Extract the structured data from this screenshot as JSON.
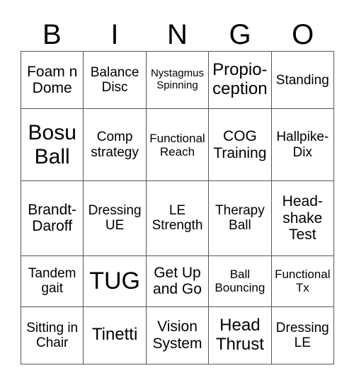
{
  "header": [
    "B",
    "I",
    "N",
    "G",
    "O"
  ],
  "rows": [
    [
      "Foam n Dome",
      "Balance Disc",
      "Nystagmus Spinning",
      "Propio-ception",
      "Standing"
    ],
    [
      "Bosu Ball",
      "Comp strategy",
      "Functional Reach",
      "COG Training",
      "Hallpike-Dix"
    ],
    [
      "Brandt-Daroff",
      "Dressing UE",
      "LE Strength",
      "Therapy Ball",
      "Head-shake Test"
    ],
    [
      "Tandem gait",
      "TUG",
      "Get Up and Go",
      "Ball Bouncing",
      "Functional Tx"
    ],
    [
      "Sitting in Chair",
      "Tinetti",
      "Vision System",
      "Head Thrust",
      "Dressing LE"
    ]
  ]
}
